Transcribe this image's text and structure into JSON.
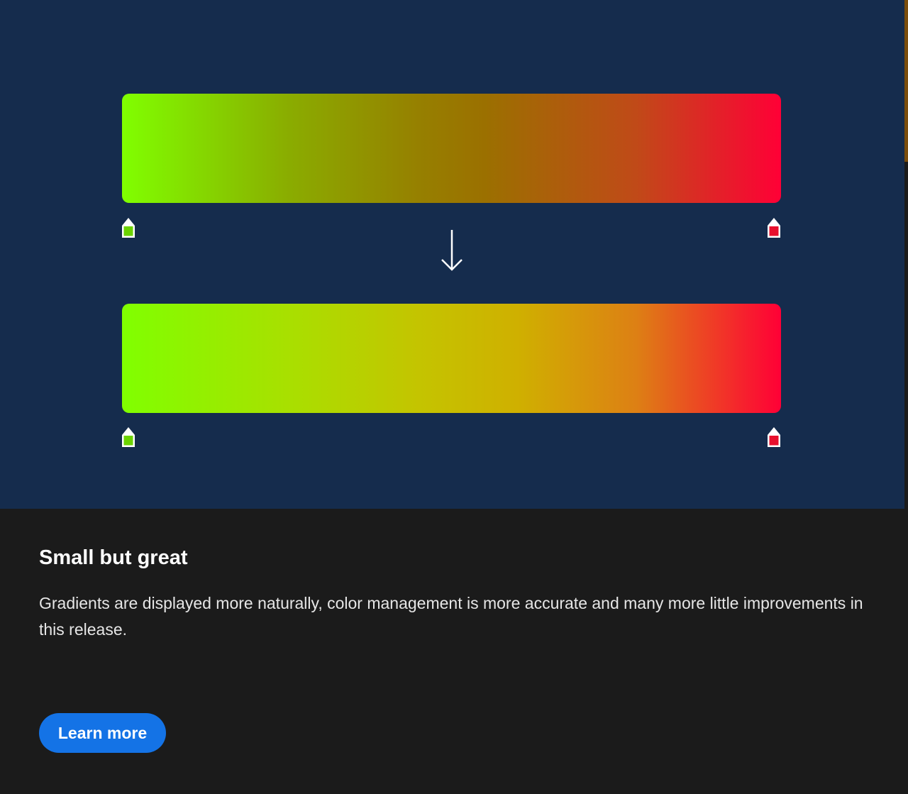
{
  "card": {
    "title": "Small but great",
    "description": "Gradients are displayed more naturally, color management is more accurate and many more little improvements in this release.",
    "button_label": "Learn more"
  },
  "illustration": {
    "start_color": "#80ff00",
    "end_color": "#ff0036",
    "arrow_icon": "arrow-down-icon"
  },
  "colors": {
    "hero_bg": "#152c4d",
    "card_bg": "#1b1b1b",
    "accent": "#1473e6"
  }
}
